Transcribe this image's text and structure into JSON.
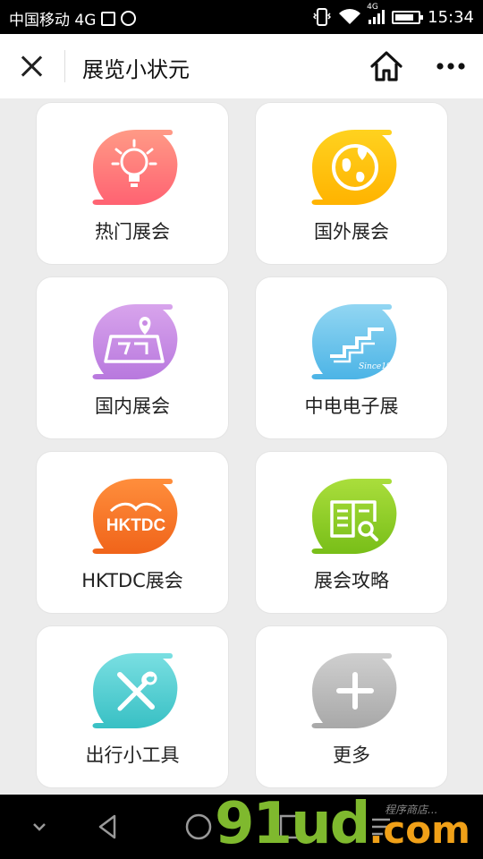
{
  "status_bar": {
    "carrier": "中国移动 4G",
    "network": "4G",
    "time": "15:34"
  },
  "header": {
    "title": "展览小状元"
  },
  "cards": [
    {
      "label": "热门展会",
      "icon": "lightbulb-icon",
      "color_top": "#ff8a7a",
      "color_bottom": "#ff5f6d"
    },
    {
      "label": "国外展会",
      "icon": "globe-pin-icon",
      "color_top": "#ffd21f",
      "color_bottom": "#ffb300"
    },
    {
      "label": "国内展会",
      "icon": "map-pin-icon",
      "color_top": "#d39ce8",
      "color_bottom": "#b979e0"
    },
    {
      "label": "中电电子展",
      "icon": "ceec-logo-icon",
      "color_top": "#8fd3f0",
      "color_bottom": "#4fb6e6",
      "icon_text": "Since1964"
    },
    {
      "label": "HKTDC展会",
      "icon": "hktdc-logo-icon",
      "color_top": "#ff8a3a",
      "color_bottom": "#f26a1b",
      "icon_text": "HKTDC"
    },
    {
      "label": "展会攻略",
      "icon": "book-search-icon",
      "color_top": "#a6dd3a",
      "color_bottom": "#7cc21b"
    },
    {
      "label": "出行小工具",
      "icon": "tools-icon",
      "color_top": "#74dce0",
      "color_bottom": "#3cc4c8"
    },
    {
      "label": "更多",
      "icon": "plus-icon",
      "color_top": "#c9c9c9",
      "color_bottom": "#a9a9a9"
    }
  ],
  "watermark": {
    "text": "91ud",
    "suffix": ".com",
    "small_text": "程序商店..."
  }
}
